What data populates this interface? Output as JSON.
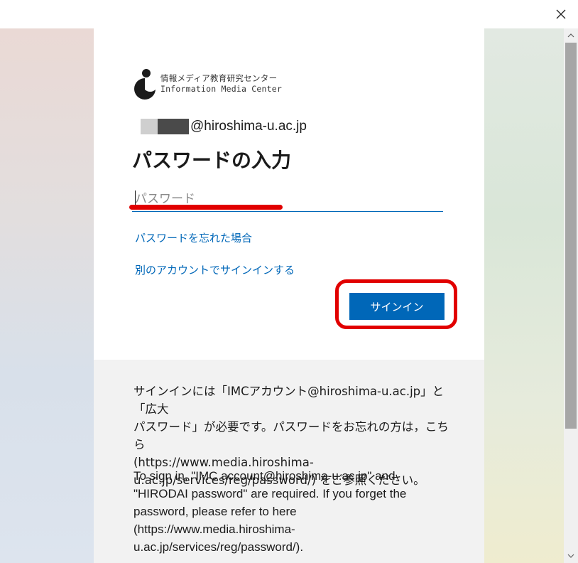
{
  "logo": {
    "name_jp": "情報メディア教育研究センター",
    "name_en": "Information Media Center"
  },
  "identity": {
    "domain": "@hiroshima-u.ac.jp"
  },
  "heading": "パスワードの入力",
  "password": {
    "placeholder": "パスワード",
    "value": ""
  },
  "links": {
    "forgot": "パスワードを忘れた場合",
    "other_account": "別のアカウントでサインインする"
  },
  "signin_button": "サインイン",
  "info": {
    "jp": "サインインには「IMCアカウント@hiroshima-u.ac.jp」と「広大\nパスワード」が必要です。パスワードをお忘れの方は，こちら\n(https://www.media.hiroshima-\nu.ac.jp/services/reg/password/) をご参照ください。",
    "en": "To sign in, \"IMC account@hiroshima-u.ac.jp\" and\n\"HIRODAI password\" are required. If you forget the\npassword, please refer to here\n(https://www.media.hiroshima-\nu.ac.jp/services/reg/password/)."
  },
  "colors": {
    "accent": "#0067b8",
    "highlight": "#e10000"
  },
  "icons": {
    "close": "close-icon",
    "scroll_up": "chevron-up-icon",
    "scroll_down": "chevron-down-icon"
  }
}
